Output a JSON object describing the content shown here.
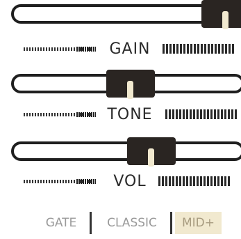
{
  "sliders": [
    {
      "label": "GAIN",
      "value": 1.0
    },
    {
      "label": "TONE",
      "value": 0.45
    },
    {
      "label": "VOL",
      "value": 0.53
    }
  ],
  "modes": [
    {
      "label": "GATE",
      "active": false
    },
    {
      "label": "CLASSIC",
      "active": false
    },
    {
      "label": "MID+",
      "active": true
    }
  ],
  "colors": {
    "track": "#1f1f1f",
    "thumb": "#2a2522",
    "nub": "#f1e9cf",
    "active_mode_bg": "#f1e9cf",
    "inactive_text": "#9a9a9a"
  }
}
